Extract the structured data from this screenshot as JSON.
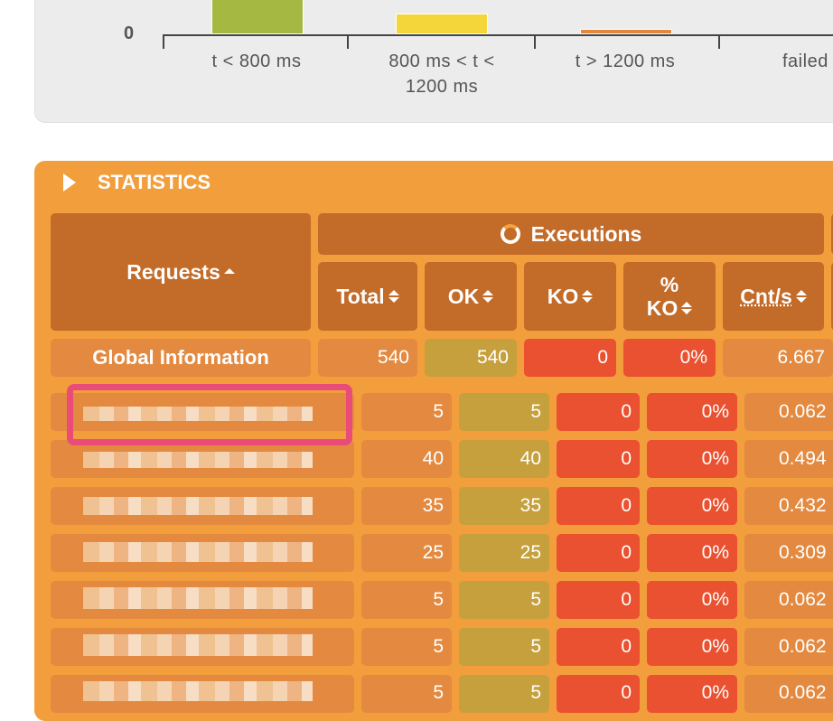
{
  "chart": {
    "zero_label": "0",
    "categories": [
      "t < 800 ms",
      "800 ms < t <",
      "1200 ms",
      "t > 1200 ms",
      "failed"
    ],
    "bars": [
      {
        "name": "t < 800 ms",
        "color": "#a5b842"
      },
      {
        "name": "800 ms < t < 1200 ms",
        "color": "#f4d53a"
      },
      {
        "name": "t > 1200 ms",
        "color": "#e3893d"
      }
    ]
  },
  "stats": {
    "title": "STATISTICS",
    "requests_header": "Requests",
    "executions_header": "Executions",
    "columns": {
      "total": "Total",
      "ok": "OK",
      "ko": "KO",
      "pct_ko_line1": "%",
      "pct_ko_line2": "KO",
      "cnt": "Cnt/s"
    },
    "global": {
      "label": "Global Information",
      "total": "540",
      "ok": "540",
      "ko": "0",
      "pct_ko": "0%",
      "cnt": "6.667"
    },
    "rows": [
      {
        "total": "5",
        "ok": "5",
        "ko": "0",
        "pct_ko": "0%",
        "cnt": "0.062"
      },
      {
        "total": "40",
        "ok": "40",
        "ko": "0",
        "pct_ko": "0%",
        "cnt": "0.494"
      },
      {
        "total": "35",
        "ok": "35",
        "ko": "0",
        "pct_ko": "0%",
        "cnt": "0.432"
      },
      {
        "total": "25",
        "ok": "25",
        "ko": "0",
        "pct_ko": "0%",
        "cnt": "0.309"
      },
      {
        "total": "5",
        "ok": "5",
        "ko": "0",
        "pct_ko": "0%",
        "cnt": "0.062"
      },
      {
        "total": "5",
        "ok": "5",
        "ko": "0",
        "pct_ko": "0%",
        "cnt": "0.062"
      },
      {
        "total": "5",
        "ok": "5",
        "ko": "0",
        "pct_ko": "0%",
        "cnt": "0.062"
      }
    ]
  }
}
